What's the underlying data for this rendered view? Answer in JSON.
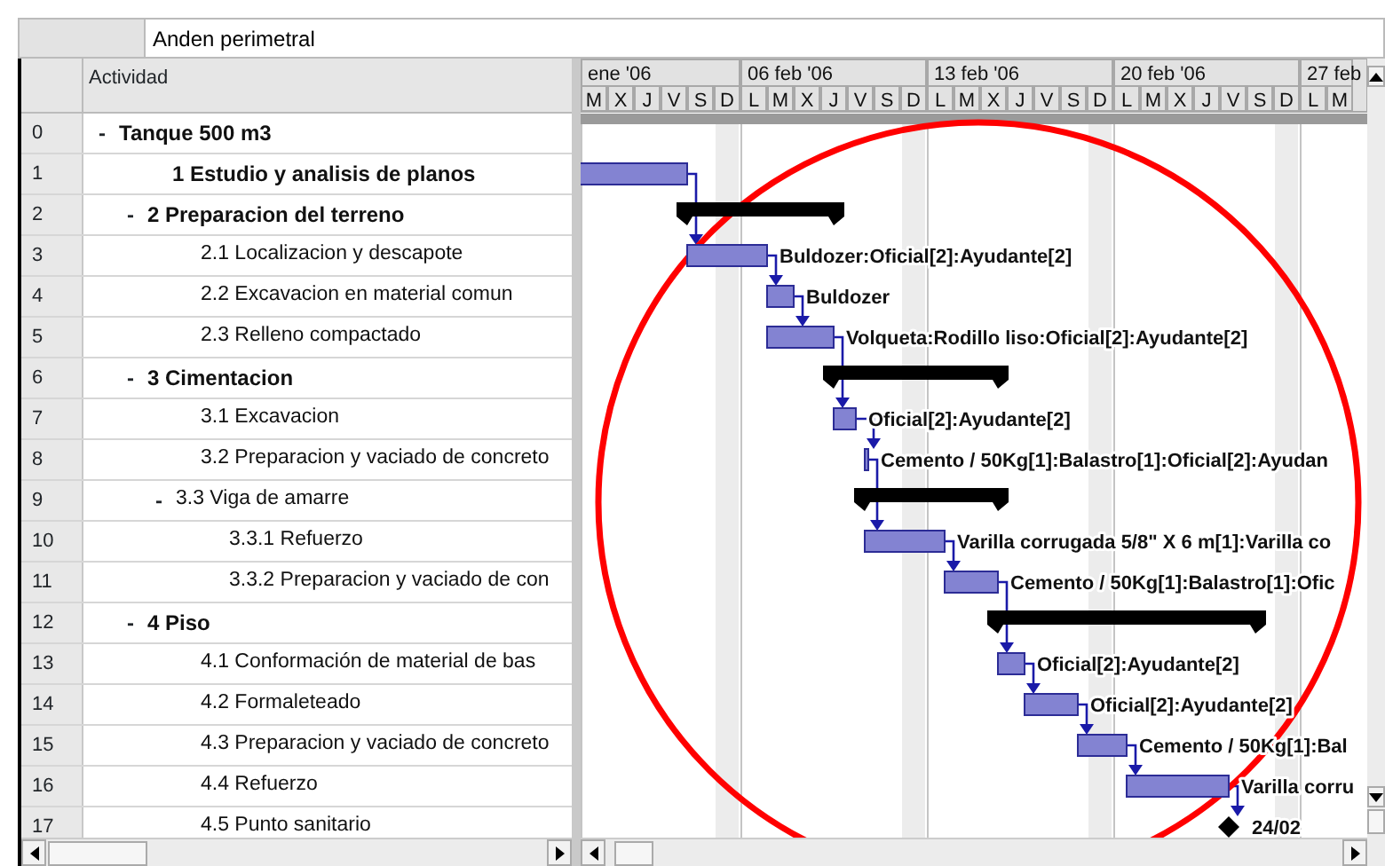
{
  "project": {
    "name": "Anden perimetral"
  },
  "table": {
    "activity_header": "Actividad"
  },
  "timescale": {
    "weeks": [
      {
        "label": "ene '06",
        "days": [
          {
            "label": "M",
            "nonworking": false
          },
          {
            "label": "X",
            "nonworking": false
          },
          {
            "label": "J",
            "nonworking": false
          },
          {
            "label": "V",
            "nonworking": false
          },
          {
            "label": "S",
            "nonworking": false
          },
          {
            "label": "D",
            "nonworking": true
          }
        ]
      },
      {
        "label": "06 feb '06",
        "days": [
          {
            "label": "L",
            "nonworking": false
          },
          {
            "label": "M",
            "nonworking": false
          },
          {
            "label": "X",
            "nonworking": false
          },
          {
            "label": "J",
            "nonworking": false
          },
          {
            "label": "V",
            "nonworking": false
          },
          {
            "label": "S",
            "nonworking": false
          },
          {
            "label": "D",
            "nonworking": true
          }
        ]
      },
      {
        "label": "13 feb '06",
        "days": [
          {
            "label": "L",
            "nonworking": false
          },
          {
            "label": "M",
            "nonworking": false
          },
          {
            "label": "X",
            "nonworking": false
          },
          {
            "label": "J",
            "nonworking": false
          },
          {
            "label": "V",
            "nonworking": false
          },
          {
            "label": "S",
            "nonworking": false
          },
          {
            "label": "D",
            "nonworking": true
          }
        ]
      },
      {
        "label": "20 feb '06",
        "days": [
          {
            "label": "L",
            "nonworking": false
          },
          {
            "label": "M",
            "nonworking": false
          },
          {
            "label": "X",
            "nonworking": false
          },
          {
            "label": "J",
            "nonworking": false
          },
          {
            "label": "V",
            "nonworking": false
          },
          {
            "label": "S",
            "nonworking": false
          },
          {
            "label": "D",
            "nonworking": true
          }
        ]
      },
      {
        "label": "27 feb",
        "days": [
          {
            "label": "L",
            "nonworking": false
          },
          {
            "label": "M",
            "nonworking": false
          }
        ]
      }
    ]
  },
  "tasks": [
    {
      "id": "0",
      "name": "Tanque 500 m3",
      "toggle": "-",
      "expanded": true,
      "children": [
        {
          "id": "1",
          "name": "1 Estudio y analisis de planos",
          "bar": {
            "kind": "task"
          }
        },
        {
          "id": "2",
          "name": "2 Preparacion del terreno",
          "toggle": "-",
          "expanded": true,
          "bar": {
            "kind": "summary"
          },
          "children": [
            {
              "id": "3",
              "name": "2.1 Localizacion y descapote",
              "bar": {
                "kind": "task",
                "label": "Buldozer:Oficial[2]:Ayudante[2]"
              }
            },
            {
              "id": "4",
              "name": "2.2 Excavacion en material comun",
              "bar": {
                "kind": "task",
                "label": "Buldozer"
              }
            },
            {
              "id": "5",
              "name": "2.3 Relleno compactado",
              "bar": {
                "kind": "task",
                "label": "Volqueta:Rodillo liso:Oficial[2]:Ayudante[2]"
              }
            }
          ]
        },
        {
          "id": "6",
          "name": "3 Cimentacion",
          "toggle": "-",
          "expanded": true,
          "bar": {
            "kind": "summary"
          },
          "children": [
            {
              "id": "7",
              "name": "3.1 Excavacion",
              "bar": {
                "kind": "task",
                "label": "Oficial[2]:Ayudante[2]"
              }
            },
            {
              "id": "8",
              "name": "3.2 Preparacion y vaciado de concreto",
              "bar": {
                "kind": "task",
                "label": "Cemento / 50Kg[1]:Balastro[1]:Oficial[2]:Ayudan"
              }
            },
            {
              "id": "9",
              "name": "3.3 Viga de amarre",
              "toggle": "-",
              "expanded": true,
              "bar": {
                "kind": "summary"
              },
              "children": [
                {
                  "id": "10",
                  "name": "3.3.1 Refuerzo",
                  "bar": {
                    "kind": "task",
                    "label": "Varilla corrugada 5/8\" X 6 m[1]:Varilla co"
                  }
                },
                {
                  "id": "11",
                  "name": "3.3.2 Preparacion y vaciado de con",
                  "bar": {
                    "kind": "task",
                    "label": "Cemento / 50Kg[1]:Balastro[1]:Ofic"
                  }
                }
              ]
            }
          ]
        },
        {
          "id": "12",
          "name": "4 Piso",
          "toggle": "-",
          "expanded": true,
          "bar": {
            "kind": "summary"
          },
          "children": [
            {
              "id": "13",
              "name": "4.1 Conformación de material de bas",
              "bar": {
                "kind": "task",
                "label": "Oficial[2]:Ayudante[2]"
              }
            },
            {
              "id": "14",
              "name": "4.2 Formaleteado",
              "bar": {
                "kind": "task",
                "label": "Oficial[2]:Ayudante[2]"
              }
            },
            {
              "id": "15",
              "name": "4.3 Preparacion y vaciado de concreto",
              "bar": {
                "kind": "task",
                "label": "Cemento / 50Kg[1]:Bal"
              }
            },
            {
              "id": "16",
              "name": "4.4 Refuerzo",
              "bar": {
                "kind": "task",
                "label": "Varilla corru"
              }
            },
            {
              "id": "17",
              "name": "4.5 Punto sanitario",
              "bar": {
                "kind": "milestone",
                "label": "24/02"
              }
            }
          ]
        }
      ]
    }
  ],
  "highlight": {
    "kind": "circle"
  }
}
